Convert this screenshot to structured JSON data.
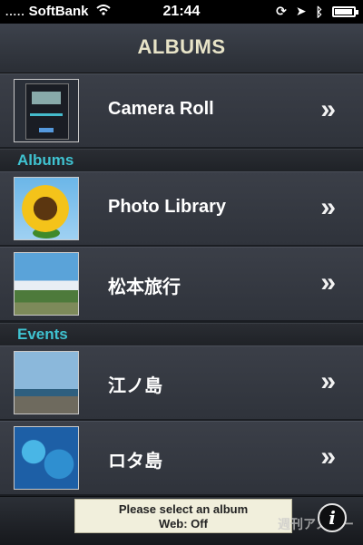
{
  "status_bar": {
    "signal": ".....",
    "carrier": "SoftBank",
    "time": "21:44"
  },
  "header": {
    "title": "ALBUMS"
  },
  "rows": {
    "camera_roll": {
      "label": "Camera Roll"
    },
    "photo_library": {
      "label": "Photo Library"
    },
    "matsumoto": {
      "label": "松本旅行"
    },
    "enoshima": {
      "label": "江ノ島"
    },
    "rota": {
      "label": "ロタ島"
    }
  },
  "sections": {
    "albums": "Albums",
    "events": "Events"
  },
  "chevron": "»",
  "footer": {
    "message_line1": "Please select an album",
    "message_line2": "Web: Off",
    "info_label": "i",
    "watermark": "週刊アスキー"
  },
  "icons": {
    "wifi": "wifi-icon",
    "rotation_lock": "rotation-lock-icon",
    "location": "location-arrow-icon",
    "bluetooth": "bluetooth-icon",
    "battery": "battery-icon",
    "chevron": "double-chevron-right-icon",
    "info": "info-icon"
  },
  "colors": {
    "section_accent": "#3fc2d0",
    "title_text": "#e8e4c8",
    "message_bg": "#f1efdc"
  },
  "battery_level": 0.85
}
